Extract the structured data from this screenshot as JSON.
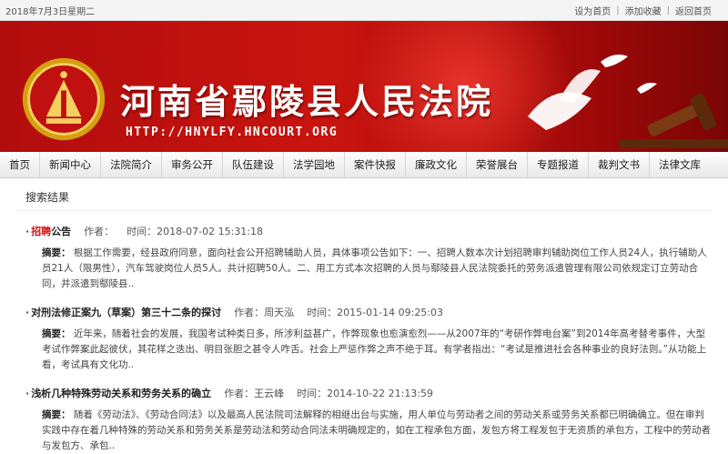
{
  "topbar": {
    "date": "2018年7月3日星期二",
    "links": [
      "设为首页",
      "添加收藏",
      "返回首页"
    ]
  },
  "banner": {
    "title": "河南省鄢陵县人民法院",
    "url": "HTTP://HNYLFY.HNCOURT.ORG"
  },
  "nav": [
    "首页",
    "新闻中心",
    "法院简介",
    "审务公开",
    "队伍建设",
    "法学园地",
    "案件快报",
    "廉政文化",
    "荣誉展台",
    "专题报道",
    "裁判文书",
    "法律文库"
  ],
  "results": {
    "heading": "搜索结果",
    "summary_label": "摘要：",
    "items": [
      {
        "title_hl": "招聘",
        "title": "公告",
        "author": "作者：",
        "time": "时间：2018-07-02 15:31:18",
        "summary": "根据工作需要，经县政府同意，面向社会公开招聘辅助人员，具体事项公告如下：一、招聘人数本次计划招聘审判辅助岗位工作人员24人，执行辅助人员21人（限男性），汽车驾驶岗位人员5人。共计招聘50人。二、用工方式本次招聘的人员与鄢陵县人民法院委托的劳务派遣管理有限公司依规定订立劳动合同，并派遣到鄢陵县.."
      },
      {
        "title_hl": "",
        "title": "对刑法修正案九（草案）第三十二条的探讨",
        "author": "作者：周天泓",
        "time": "时间：2015-01-14 09:25:03",
        "summary": "近年来，随着社会的发展，我国考试种类日多，所涉利益甚广，作弊现象也愈演愈烈——从2007年的“考研作弊电台案”到2014年高考替考事件，大型考试作弊案此起彼伏，其花样之迭出、明目张胆之甚令人咋舌。社会上严惩作弊之声不绝于耳。有学者指出：“考试是推进社会各种事业的良好法则。”从功能上看，考试具有文化功.."
      },
      {
        "title_hl": "",
        "title": "浅析几种特殊劳动关系和劳务关系的确立",
        "author": "作者：王云峰",
        "time": "时间：2014-10-22 21:13:59",
        "summary": "随着《劳动法》、《劳动合同法》以及最高人民法院司法解释的相继出台与实施，用人单位与劳动者之间的劳动关系或劳务关系都已明确确立。但在审判实践中存在着几种特殊的劳动关系和劳务关系是劳动法和劳动合同法未明确规定的，如在工程承包方面，发包方将工程发包于无资质的承包方，工程中的劳动者与发包方、承包.."
      }
    ]
  }
}
